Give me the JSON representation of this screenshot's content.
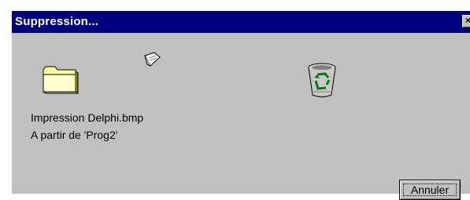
{
  "dialog": {
    "title": "Suppression...",
    "close_glyph": "×",
    "file_line": "Impression Delphi.bmp",
    "source_line": "A partir de  'Prog2'",
    "cancel_label": "Annuler"
  },
  "icons": {
    "source": "folder-icon",
    "moving": "paper-document-icon",
    "destination": "recycle-bin-icon"
  },
  "colors": {
    "titlebar": "#000080",
    "dialog_face": "#c0c0c0",
    "folder_yellow": "#ffff99",
    "recycle_green": "#008000"
  }
}
